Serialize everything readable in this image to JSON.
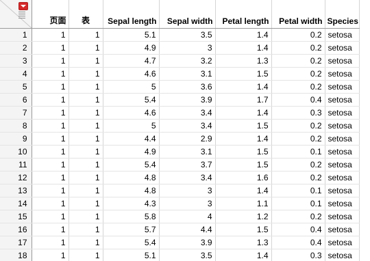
{
  "corner": {
    "menu_icon": "red-triangle-menu-icon",
    "rows_icon": "row-lines-icon"
  },
  "columns": [
    "页面",
    "表",
    "Sepal length",
    "Sepal width",
    "Petal length",
    "Petal width",
    "Species"
  ],
  "rows": [
    {
      "n": "1",
      "page": "1",
      "table": "1",
      "sl": "5.1",
      "sw": "3.5",
      "pl": "1.4",
      "pw": "0.2",
      "sp": "setosa"
    },
    {
      "n": "2",
      "page": "1",
      "table": "1",
      "sl": "4.9",
      "sw": "3",
      "pl": "1.4",
      "pw": "0.2",
      "sp": "setosa"
    },
    {
      "n": "3",
      "page": "1",
      "table": "1",
      "sl": "4.7",
      "sw": "3.2",
      "pl": "1.3",
      "pw": "0.2",
      "sp": "setosa"
    },
    {
      "n": "4",
      "page": "1",
      "table": "1",
      "sl": "4.6",
      "sw": "3.1",
      "pl": "1.5",
      "pw": "0.2",
      "sp": "setosa"
    },
    {
      "n": "5",
      "page": "1",
      "table": "1",
      "sl": "5",
      "sw": "3.6",
      "pl": "1.4",
      "pw": "0.2",
      "sp": "setosa"
    },
    {
      "n": "6",
      "page": "1",
      "table": "1",
      "sl": "5.4",
      "sw": "3.9",
      "pl": "1.7",
      "pw": "0.4",
      "sp": "setosa"
    },
    {
      "n": "7",
      "page": "1",
      "table": "1",
      "sl": "4.6",
      "sw": "3.4",
      "pl": "1.4",
      "pw": "0.3",
      "sp": "setosa"
    },
    {
      "n": "8",
      "page": "1",
      "table": "1",
      "sl": "5",
      "sw": "3.4",
      "pl": "1.5",
      "pw": "0.2",
      "sp": "setosa"
    },
    {
      "n": "9",
      "page": "1",
      "table": "1",
      "sl": "4.4",
      "sw": "2.9",
      "pl": "1.4",
      "pw": "0.2",
      "sp": "setosa"
    },
    {
      "n": "10",
      "page": "1",
      "table": "1",
      "sl": "4.9",
      "sw": "3.1",
      "pl": "1.5",
      "pw": "0.1",
      "sp": "setosa"
    },
    {
      "n": "11",
      "page": "1",
      "table": "1",
      "sl": "5.4",
      "sw": "3.7",
      "pl": "1.5",
      "pw": "0.2",
      "sp": "setosa"
    },
    {
      "n": "12",
      "page": "1",
      "table": "1",
      "sl": "4.8",
      "sw": "3.4",
      "pl": "1.6",
      "pw": "0.2",
      "sp": "setosa"
    },
    {
      "n": "13",
      "page": "1",
      "table": "1",
      "sl": "4.8",
      "sw": "3",
      "pl": "1.4",
      "pw": "0.1",
      "sp": "setosa"
    },
    {
      "n": "14",
      "page": "1",
      "table": "1",
      "sl": "4.3",
      "sw": "3",
      "pl": "1.1",
      "pw": "0.1",
      "sp": "setosa"
    },
    {
      "n": "15",
      "page": "1",
      "table": "1",
      "sl": "5.8",
      "sw": "4",
      "pl": "1.2",
      "pw": "0.2",
      "sp": "setosa"
    },
    {
      "n": "16",
      "page": "1",
      "table": "1",
      "sl": "5.7",
      "sw": "4.4",
      "pl": "1.5",
      "pw": "0.4",
      "sp": "setosa"
    },
    {
      "n": "17",
      "page": "1",
      "table": "1",
      "sl": "5.4",
      "sw": "3.9",
      "pl": "1.3",
      "pw": "0.4",
      "sp": "setosa"
    },
    {
      "n": "18",
      "page": "1",
      "table": "1",
      "sl": "5.1",
      "sw": "3.5",
      "pl": "1.4",
      "pw": "0.3",
      "sp": "setosa"
    }
  ]
}
